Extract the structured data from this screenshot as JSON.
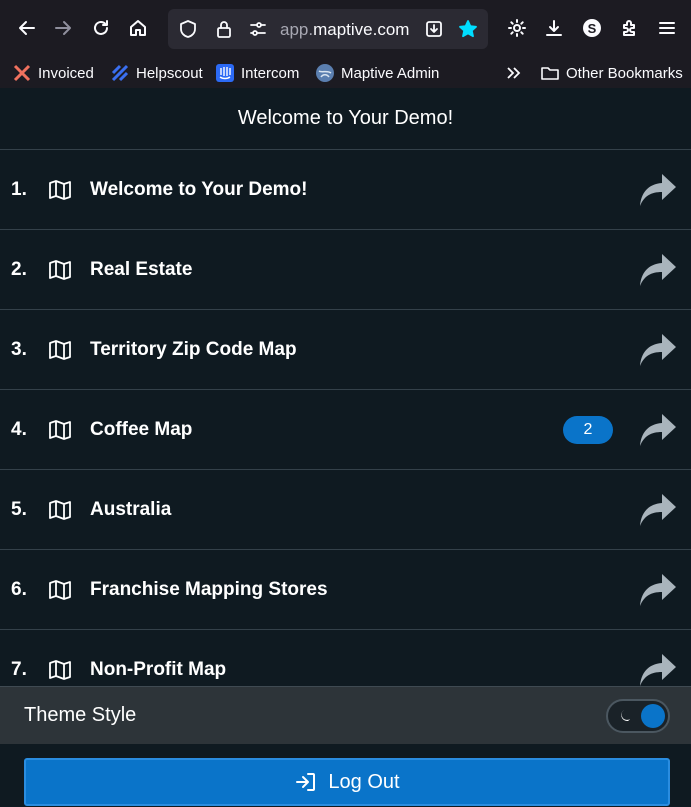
{
  "browser": {
    "url_prefix": "app.",
    "url_domain": "maptive.com",
    "bookmarks": [
      {
        "label": "Invoiced",
        "icon": "invoiced-icon"
      },
      {
        "label": "Helpscout",
        "icon": "helpscout-icon"
      },
      {
        "label": "Intercom",
        "icon": "intercom-icon"
      },
      {
        "label": "Maptive Admin",
        "icon": "maptive-icon"
      }
    ],
    "other_bookmarks": "Other Bookmarks",
    "profile_letter": "S"
  },
  "header": {
    "title": "Welcome to Your Demo!"
  },
  "maps": [
    {
      "num": "1.",
      "label": "Welcome to Your Demo!",
      "badge": ""
    },
    {
      "num": "2.",
      "label": "Real Estate",
      "badge": ""
    },
    {
      "num": "3.",
      "label": "Territory Zip Code Map",
      "badge": ""
    },
    {
      "num": "4.",
      "label": "Coffee Map",
      "badge": "2"
    },
    {
      "num": "5.",
      "label": "Australia",
      "badge": ""
    },
    {
      "num": "6.",
      "label": "Franchise Mapping Stores",
      "badge": ""
    },
    {
      "num": "7.",
      "label": "Non-Profit Map",
      "badge": ""
    }
  ],
  "theme": {
    "label": "Theme Style",
    "mode": "dark"
  },
  "logout": {
    "label": "Log Out"
  },
  "colors": {
    "accent": "#0a74c9",
    "background": "#0f1a21",
    "arrow": "#a9b4bc"
  }
}
